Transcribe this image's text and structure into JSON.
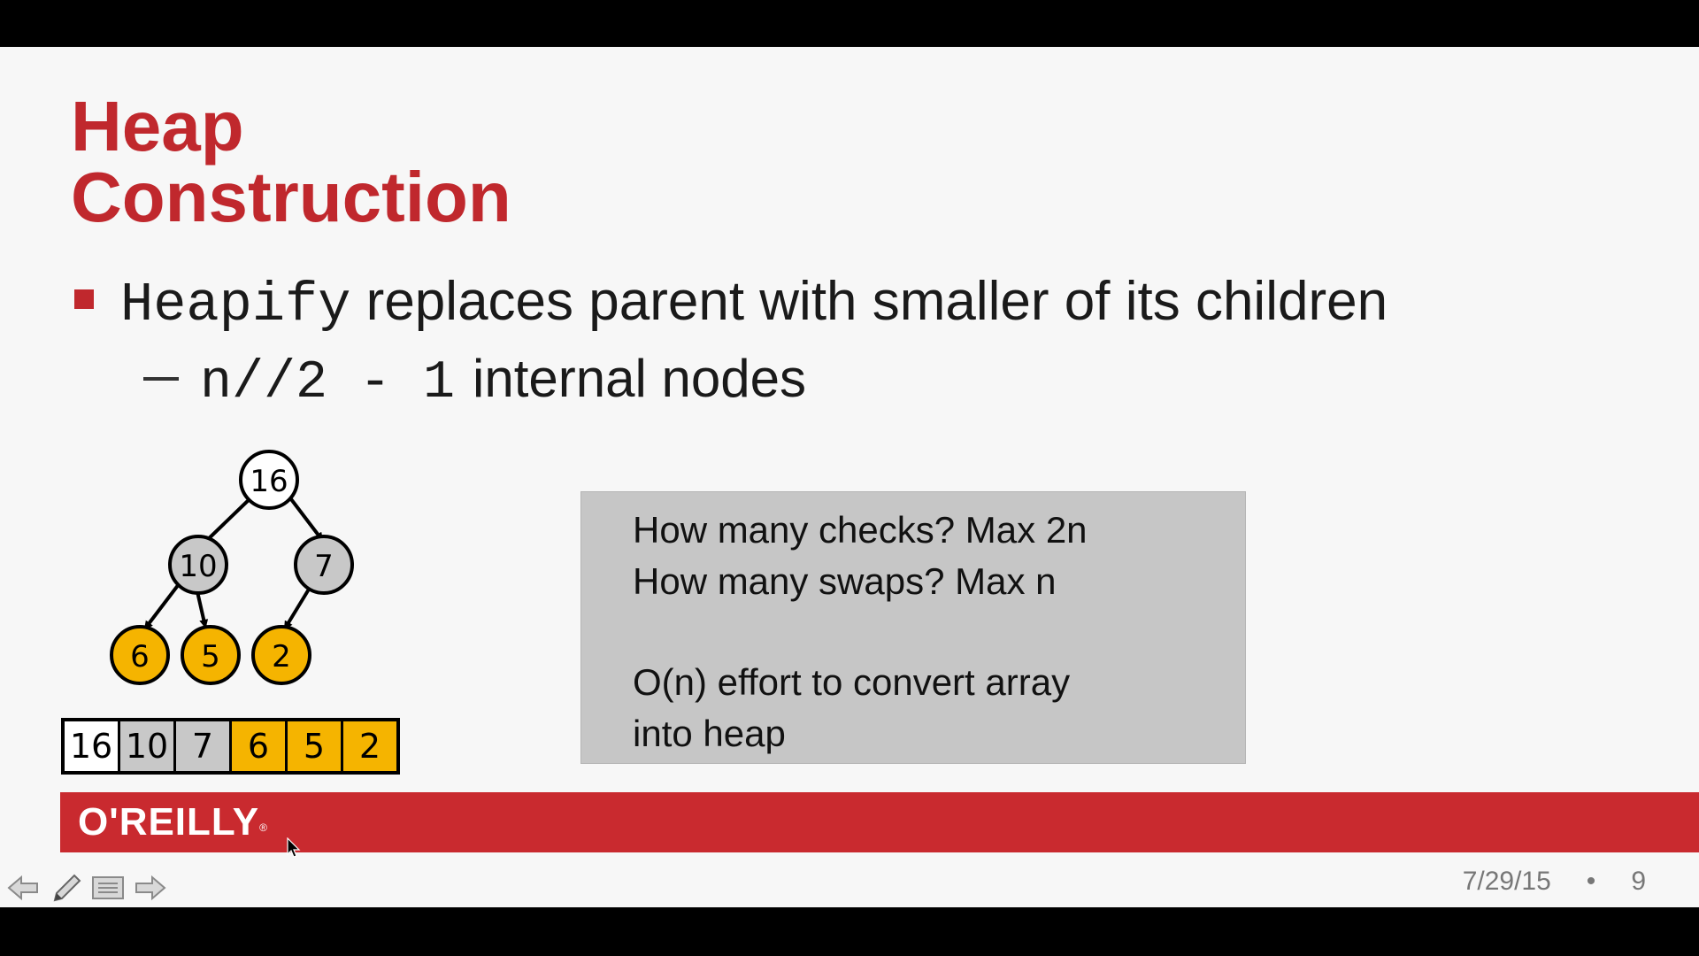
{
  "slide": {
    "title_line1": "Heap",
    "title_line2": "Construction",
    "bullet": {
      "code": "Heapify",
      "text": " replaces parent with smaller of its children"
    },
    "sub_bullet": {
      "code": "n//2 - 1",
      "text": "internal nodes"
    },
    "tree": {
      "root": "16",
      "level1": [
        "10",
        "7"
      ],
      "level2": [
        "6",
        "5",
        "2"
      ]
    },
    "array": [
      {
        "value": "16",
        "color": "white"
      },
      {
        "value": "10",
        "color": "gray"
      },
      {
        "value": "7",
        "color": "gray"
      },
      {
        "value": "6",
        "color": "yellow"
      },
      {
        "value": "5",
        "color": "yellow"
      },
      {
        "value": "2",
        "color": "yellow"
      }
    ],
    "note": {
      "line1": "How many checks? Max 2n",
      "line2": "How many swaps? Max n",
      "line3": "O(n) effort to convert array",
      "line4": "into heap"
    },
    "brand": "O'REILLY",
    "brand_mark": "®",
    "date": "7/29/15",
    "separator": "•",
    "page_number": "9"
  },
  "colors": {
    "accent_red": "#c0282d",
    "node_gray": "#c8c8c8",
    "node_yellow": "#f5b400",
    "note_bg": "#c6c6c6"
  },
  "icons": [
    "arrow-left-icon",
    "pen-icon",
    "menu-icon",
    "arrow-right-icon"
  ]
}
